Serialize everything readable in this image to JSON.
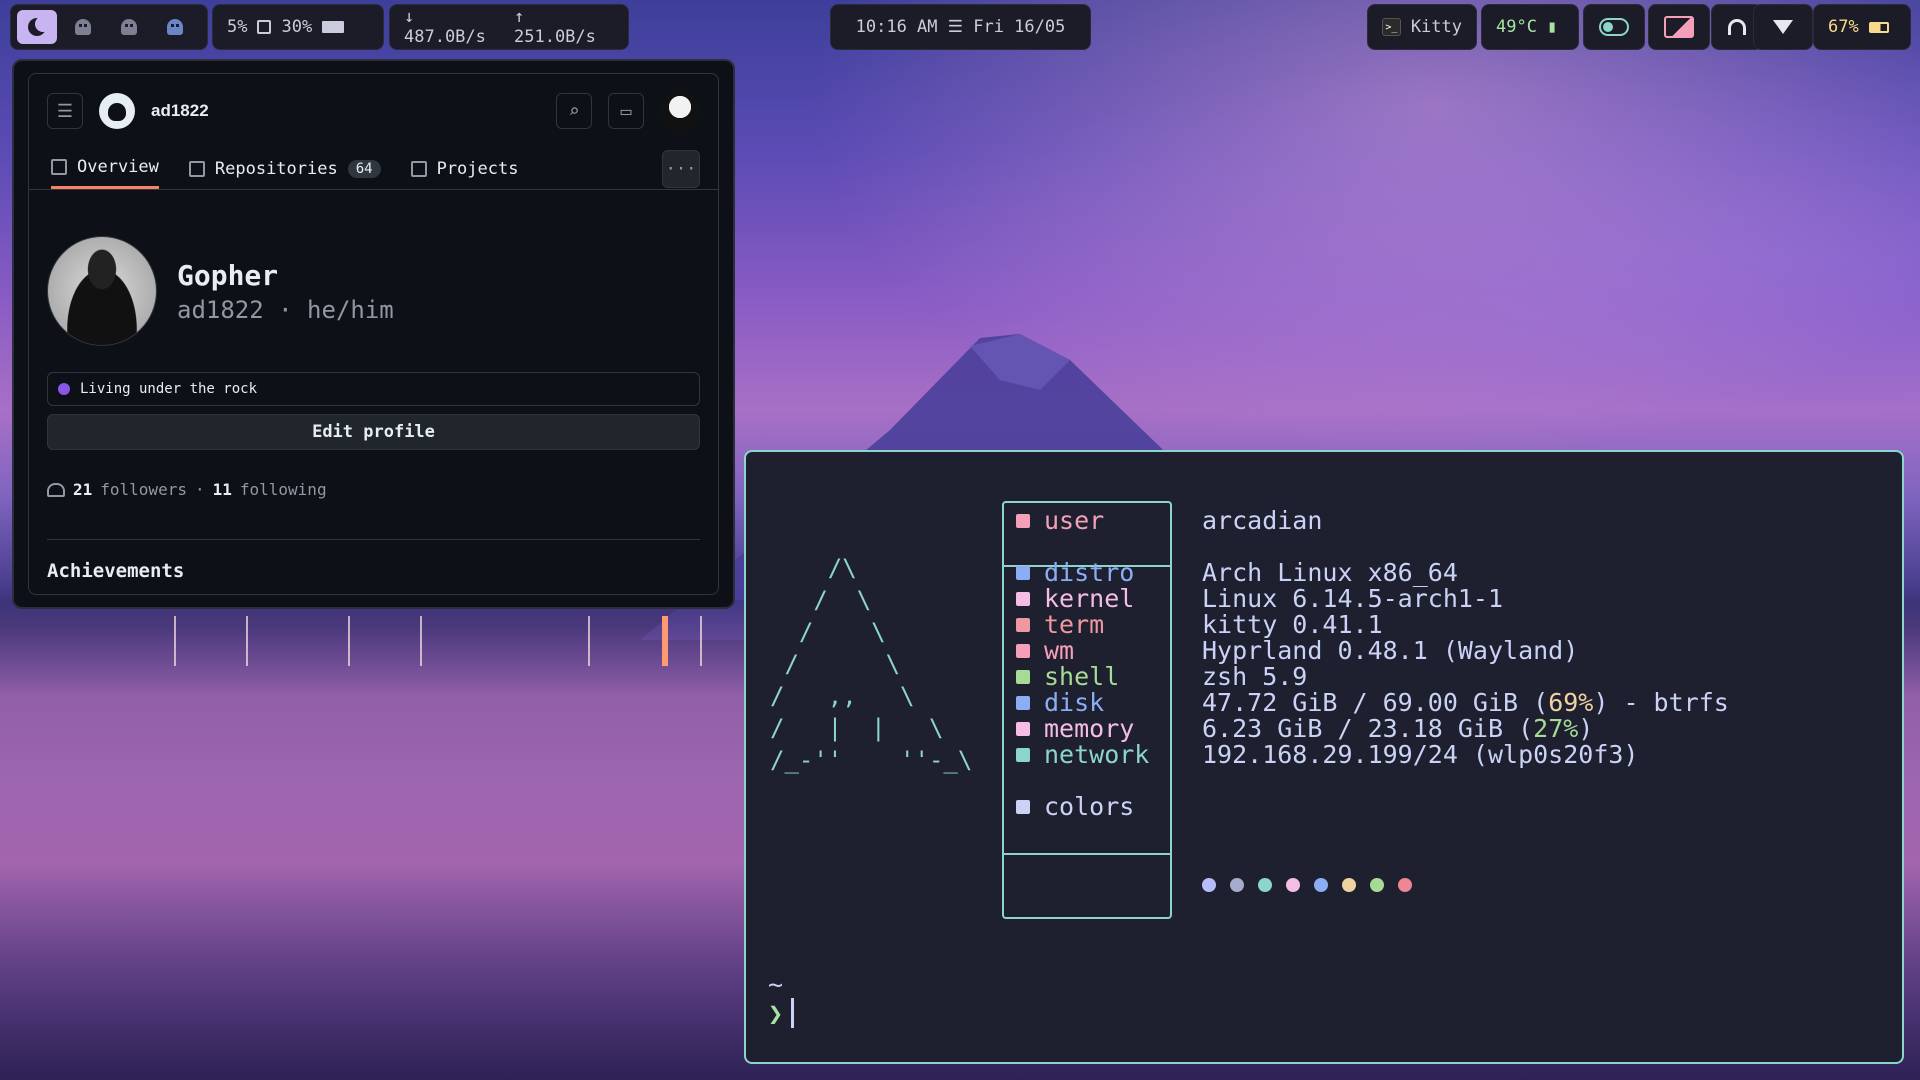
{
  "topbar": {
    "cpu": "5%",
    "ram": "30%",
    "net_down": "↓ 487.0B/s",
    "net_up": "↑ 251.0B/s",
    "clock": "10:16 AM ☰ Fri 16/05",
    "active_app": "Kitty",
    "temperature": "49°C",
    "battery": "67%"
  },
  "github": {
    "username": "ad1822",
    "tabs": [
      {
        "label": "Overview"
      },
      {
        "label": "Repositories",
        "count": "64"
      },
      {
        "label": "Projects"
      }
    ],
    "name": "Gopher",
    "handle_line": "ad1822 · he/him",
    "status": "Living under the rock",
    "edit_label": "Edit profile",
    "followers_count": "21",
    "followers_label": "followers",
    "sep": "·",
    "following_count": "11",
    "following_label": "following",
    "section": "Achievements"
  },
  "terminal": {
    "ascii": "    /\\\n   /  \\\n  /    \\\n /      \\\n/   ,,   \\\n/   |  |   \\\n/_-''    ''-_\\",
    "rows": [
      {
        "key": "user",
        "value": "arcadian",
        "color": "#f5a0b8"
      },
      {
        "key": "distro",
        "value": "Arch Linux x86_64",
        "color": "#8aadf4"
      },
      {
        "key": "kernel",
        "value": "Linux 6.14.5-arch1-1",
        "color": "#f5bde6"
      },
      {
        "key": "term",
        "value": "kitty 0.41.1",
        "color": "#ee99a0"
      },
      {
        "key": "wm",
        "value": "Hyprland 0.48.1 (Wayland)",
        "color": "#f5a0b8"
      },
      {
        "key": "shell",
        "value": "zsh 5.9",
        "color": "#a6da95"
      },
      {
        "key": "disk",
        "value_a": "47.72 GiB / 69.00 GiB (",
        "value_hi": "69%",
        "value_b": ") - btrfs",
        "color": "#8aadf4",
        "hi_color": "#eed49f"
      },
      {
        "key": "memory",
        "value_a": "6.23 GiB / 23.18 GiB (",
        "value_hi": "27%",
        "value_b": ")",
        "color": "#f5bde6",
        "hi_color": "#a6da95"
      },
      {
        "key": "network",
        "value": "192.168.29.199/24 (wlp0s20f3)",
        "color": "#8bd5ca"
      },
      {
        "key": "colors",
        "color": "#cad3f5"
      }
    ],
    "palette": [
      "#b7bdf8",
      "#a5adcb",
      "#8bd5ca",
      "#f5bde6",
      "#8aadf4",
      "#eed49f",
      "#a6da95",
      "#ed8796"
    ],
    "prompt_dir": "~",
    "prompt_symbol": "❯"
  }
}
